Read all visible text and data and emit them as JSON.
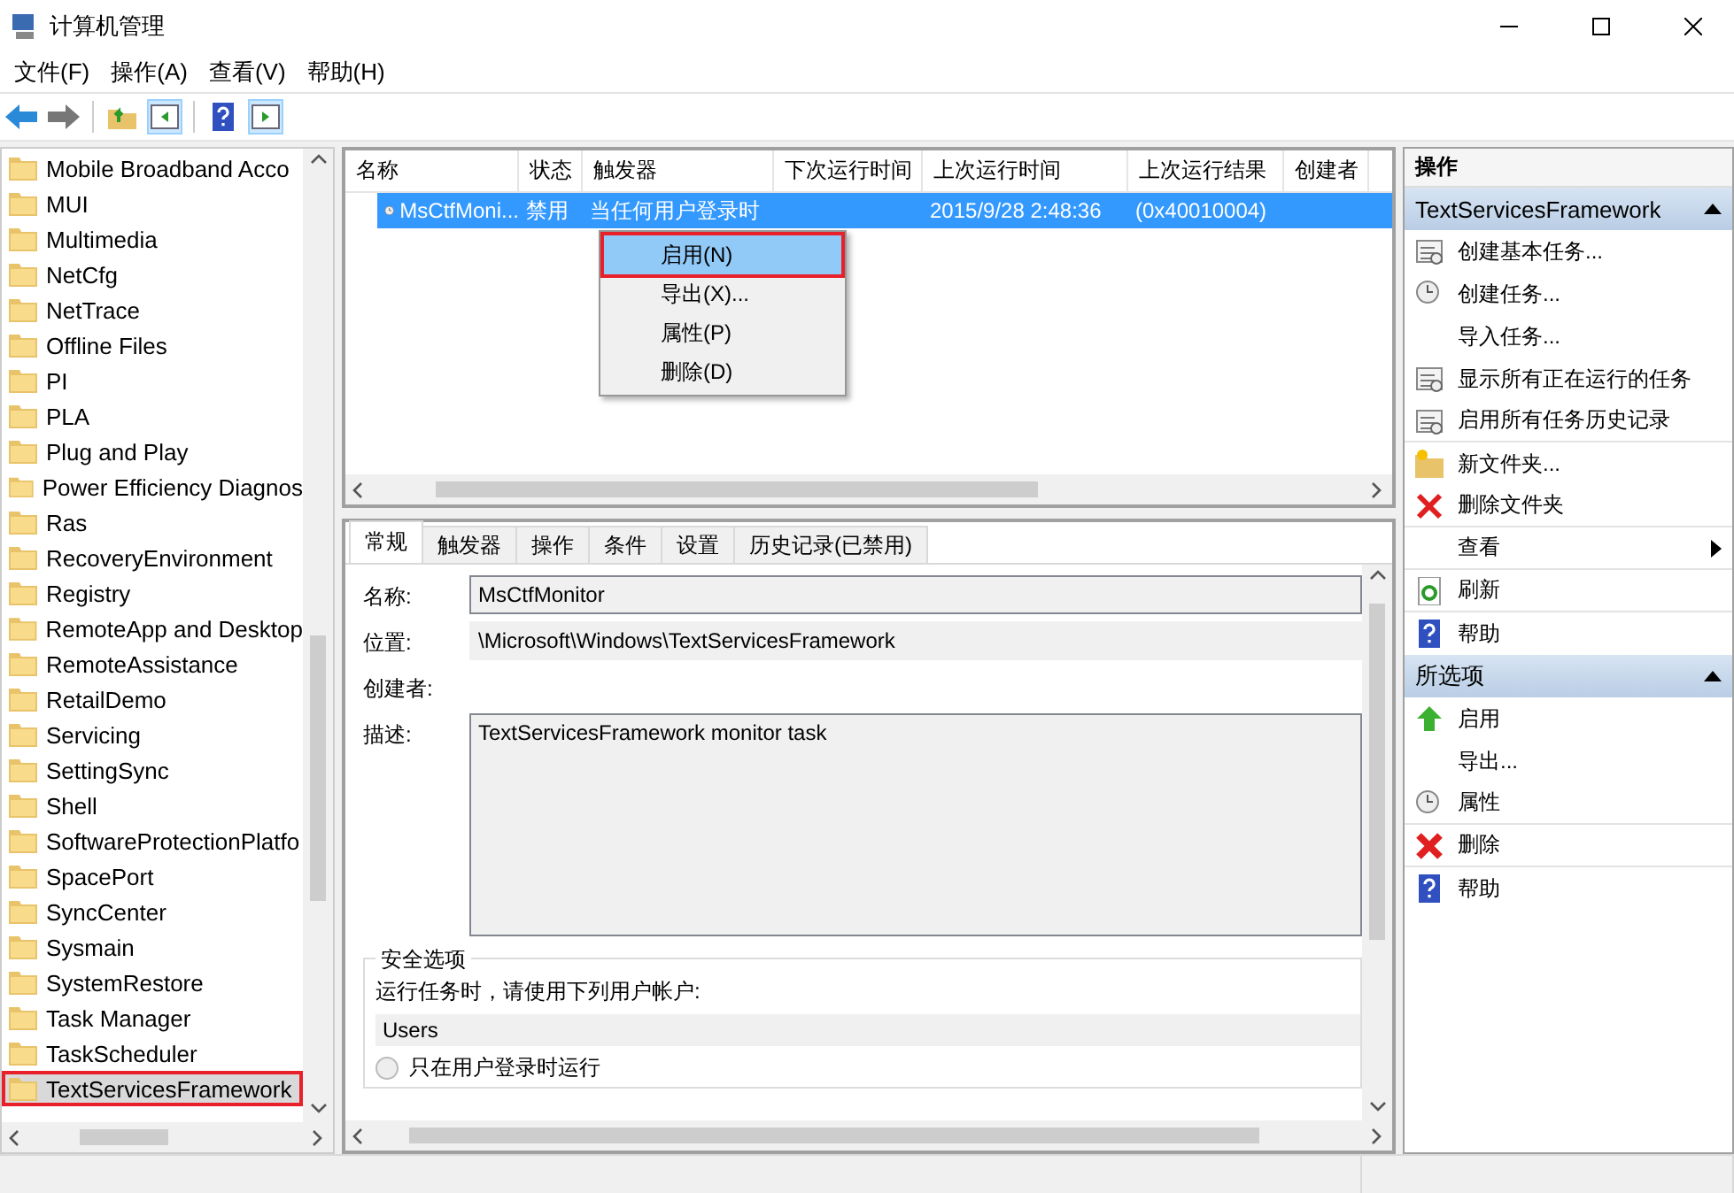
{
  "window": {
    "title": "计算机管理"
  },
  "menu": [
    "文件(F)",
    "操作(A)",
    "查看(V)",
    "帮助(H)"
  ],
  "tree": {
    "items": [
      {
        "label": "Mobile Broadband Acco",
        "selected": false
      },
      {
        "label": "MUI",
        "selected": false
      },
      {
        "label": "Multimedia",
        "selected": false
      },
      {
        "label": "NetCfg",
        "selected": false
      },
      {
        "label": "NetTrace",
        "selected": false
      },
      {
        "label": "Offline Files",
        "selected": false
      },
      {
        "label": "PI",
        "selected": false
      },
      {
        "label": "PLA",
        "selected": false
      },
      {
        "label": "Plug and Play",
        "selected": false
      },
      {
        "label": "Power Efficiency Diagnos",
        "selected": false
      },
      {
        "label": "Ras",
        "selected": false
      },
      {
        "label": "RecoveryEnvironment",
        "selected": false
      },
      {
        "label": "Registry",
        "selected": false
      },
      {
        "label": "RemoteApp and Desktop",
        "selected": false
      },
      {
        "label": "RemoteAssistance",
        "selected": false
      },
      {
        "label": "RetailDemo",
        "selected": false
      },
      {
        "label": "Servicing",
        "selected": false
      },
      {
        "label": "SettingSync",
        "selected": false
      },
      {
        "label": "Shell",
        "selected": false
      },
      {
        "label": "SoftwareProtectionPlatfo",
        "selected": false
      },
      {
        "label": "SpacePort",
        "selected": false
      },
      {
        "label": "SyncCenter",
        "selected": false
      },
      {
        "label": "Sysmain",
        "selected": false
      },
      {
        "label": "SystemRestore",
        "selected": false
      },
      {
        "label": "Task Manager",
        "selected": false
      },
      {
        "label": "TaskScheduler",
        "selected": false
      },
      {
        "label": "TextServicesFramework",
        "selected": true
      }
    ]
  },
  "tasks": {
    "columns": [
      "名称",
      "状态",
      "触发器",
      "下次运行时间",
      "上次运行时间",
      "上次运行结果",
      "创建者"
    ],
    "rows": [
      {
        "cells": [
          "MsCtfMoni...",
          "禁用",
          "当任何用户登录时",
          "",
          "2015/9/28 2:48:36",
          "(0x40010004)",
          ""
        ],
        "selected": true
      }
    ]
  },
  "context_menu": {
    "items": [
      {
        "label": "启用(N)",
        "highlighted": true
      },
      {
        "label": "导出(X)...",
        "highlighted": false
      },
      {
        "label": "属性(P)",
        "highlighted": false
      },
      {
        "label": "删除(D)",
        "highlighted": false
      }
    ]
  },
  "details": {
    "tabs": [
      {
        "label": "常规",
        "selected": true
      },
      {
        "label": "触发器",
        "selected": false
      },
      {
        "label": "操作",
        "selected": false
      },
      {
        "label": "条件",
        "selected": false
      },
      {
        "label": "设置",
        "selected": false
      },
      {
        "label": "历史记录(已禁用)",
        "selected": false
      }
    ],
    "name_label": "名称:",
    "name_value": "MsCtfMonitor",
    "location_label": "位置:",
    "location_value": "\\Microsoft\\Windows\\TextServicesFramework",
    "author_label": "创建者:",
    "description_label": "描述:",
    "description_value": "TextServicesFramework monitor task",
    "security_title": "安全选项",
    "run_as_label": "运行任务时，请使用下列用户帐户:",
    "run_as_value": "Users",
    "radio_label": "只在用户登录时运行",
    "radio_selected": false
  },
  "actions": {
    "title": "操作",
    "sections": [
      {
        "title": "TextServicesFramework",
        "expanded": true,
        "items": [
          {
            "label": "创建基本任务...",
            "divider_after": false,
            "submenu": false
          },
          {
            "label": "创建任务...",
            "divider_after": false,
            "submenu": false
          },
          {
            "label": "导入任务...",
            "divider_after": false,
            "submenu": false
          },
          {
            "label": "显示所有正在运行的任务",
            "divider_after": false,
            "submenu": false
          },
          {
            "label": "启用所有任务历史记录",
            "divider_after": true,
            "submenu": false
          },
          {
            "label": "新文件夹...",
            "divider_after": false,
            "submenu": false
          },
          {
            "label": "删除文件夹",
            "divider_after": true,
            "submenu": false
          },
          {
            "label": "查看",
            "divider_after": true,
            "submenu": true
          },
          {
            "label": "刷新",
            "divider_after": true,
            "submenu": false
          },
          {
            "label": "帮助",
            "divider_after": false,
            "submenu": false
          }
        ]
      },
      {
        "title": "所选项",
        "expanded": true,
        "items": [
          {
            "label": "启用",
            "divider_after": false,
            "submenu": false
          },
          {
            "label": "导出...",
            "divider_after": false,
            "submenu": false
          },
          {
            "label": "属性",
            "divider_after": true,
            "submenu": false
          },
          {
            "label": "删除",
            "divider_after": true,
            "submenu": false
          },
          {
            "label": "帮助",
            "divider_after": false,
            "submenu": false
          }
        ]
      }
    ]
  }
}
